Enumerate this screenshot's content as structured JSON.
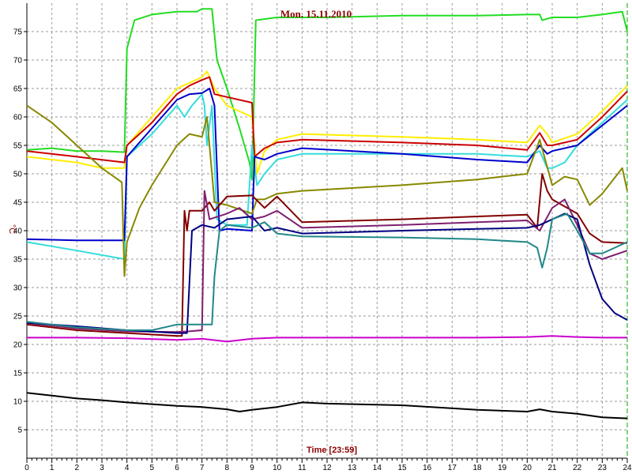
{
  "chart_data": {
    "type": "line",
    "title": "Mon. 15.11.2010",
    "xlabel": "Time [23:59]",
    "ylabel": "°C",
    "xlim": [
      0,
      24
    ],
    "ylim": [
      0,
      80
    ],
    "grid": true,
    "x_ticks": [
      "0",
      "1",
      "2",
      "3",
      "4",
      "5",
      "6",
      "7",
      "8",
      "9",
      "10",
      "11",
      "12",
      "13",
      "14",
      "15",
      "16",
      "17",
      "18",
      "19",
      "20",
      "21",
      "22",
      "23",
      "24"
    ],
    "y_ticks": [
      "5",
      "10",
      "15",
      "20",
      "25",
      "30",
      "35",
      "40",
      "45",
      "50",
      "55",
      "60",
      "65",
      "70",
      "75"
    ],
    "series": [
      {
        "color": "#22dd22",
        "points": [
          [
            0,
            54.2
          ],
          [
            1,
            54.5
          ],
          [
            2,
            54
          ],
          [
            3,
            54
          ],
          [
            3.9,
            53.8
          ],
          [
            4,
            72
          ],
          [
            4.3,
            77
          ],
          [
            5,
            78
          ],
          [
            6,
            78.5
          ],
          [
            6.8,
            78.5
          ],
          [
            7,
            79
          ],
          [
            7.4,
            79
          ],
          [
            7.6,
            70
          ],
          [
            8,
            65
          ],
          [
            8.5,
            58
          ],
          [
            8.9,
            52
          ],
          [
            9,
            49
          ],
          [
            9.15,
            77
          ],
          [
            10,
            77.5
          ],
          [
            12,
            77.5
          ],
          [
            15,
            77.8
          ],
          [
            18,
            77.8
          ],
          [
            20,
            78
          ],
          [
            20.5,
            78
          ],
          [
            20.6,
            77
          ],
          [
            21,
            77.5
          ],
          [
            22,
            77.5
          ],
          [
            23,
            78
          ],
          [
            23.8,
            78.5
          ],
          [
            24,
            75
          ]
        ]
      },
      {
        "color": "#ffee00",
        "points": [
          [
            0,
            53
          ],
          [
            2,
            52
          ],
          [
            3,
            51
          ],
          [
            3.9,
            51
          ],
          [
            4,
            55
          ],
          [
            5,
            60
          ],
          [
            6,
            65
          ],
          [
            6.5,
            66
          ],
          [
            7,
            67
          ],
          [
            7.2,
            68
          ],
          [
            7.5,
            65
          ],
          [
            8,
            62
          ],
          [
            9,
            60
          ],
          [
            9.2,
            50
          ],
          [
            9.5,
            54
          ],
          [
            10,
            56
          ],
          [
            11,
            57
          ],
          [
            15,
            56.5
          ],
          [
            18,
            56
          ],
          [
            20,
            55.5
          ],
          [
            20.5,
            58.5
          ],
          [
            20.8,
            57
          ],
          [
            21,
            55.5
          ],
          [
            22,
            57
          ],
          [
            23,
            61
          ],
          [
            24,
            65.5
          ]
        ]
      },
      {
        "color": "#cc0000",
        "points": [
          [
            0,
            54
          ],
          [
            2,
            53
          ],
          [
            3.9,
            52
          ],
          [
            4,
            55
          ],
          [
            5,
            59
          ],
          [
            6,
            64
          ],
          [
            6.5,
            65.5
          ],
          [
            7,
            66.5
          ],
          [
            7.3,
            67
          ],
          [
            7.5,
            64
          ],
          [
            8,
            63.5
          ],
          [
            9,
            62.5
          ],
          [
            9.1,
            53
          ],
          [
            9.5,
            54.5
          ],
          [
            10,
            55.5
          ],
          [
            11,
            56
          ],
          [
            15,
            55.5
          ],
          [
            18,
            55
          ],
          [
            20,
            54.2
          ],
          [
            20.5,
            57.2
          ],
          [
            20.8,
            55
          ],
          [
            21,
            55
          ],
          [
            22,
            56
          ],
          [
            23,
            60
          ],
          [
            24,
            64.5
          ]
        ]
      },
      {
        "color": "#33dddd",
        "points": [
          [
            0,
            38
          ],
          [
            2,
            36.5
          ],
          [
            3.9,
            35
          ],
          [
            4,
            53
          ],
          [
            5,
            57
          ],
          [
            6,
            62
          ],
          [
            6.3,
            60
          ],
          [
            6.6,
            62
          ],
          [
            7,
            64
          ],
          [
            7.1,
            62
          ],
          [
            7.2,
            55
          ],
          [
            7.4,
            62
          ],
          [
            7.6,
            42
          ],
          [
            8,
            41
          ],
          [
            8.8,
            41
          ],
          [
            9,
            55
          ],
          [
            9.2,
            48
          ],
          [
            9.5,
            50
          ],
          [
            10,
            52.5
          ],
          [
            11,
            53.5
          ],
          [
            15,
            53.5
          ],
          [
            18,
            53.5
          ],
          [
            20,
            53
          ],
          [
            20.5,
            54
          ],
          [
            20.8,
            51
          ],
          [
            21,
            51
          ],
          [
            21.5,
            52
          ],
          [
            22,
            55
          ],
          [
            23,
            59
          ],
          [
            24,
            63
          ]
        ]
      },
      {
        "color": "#0000cc",
        "points": [
          [
            0,
            38.5
          ],
          [
            2,
            38.3
          ],
          [
            3.9,
            38.3
          ],
          [
            4,
            53
          ],
          [
            5,
            58
          ],
          [
            6,
            63
          ],
          [
            6.5,
            64
          ],
          [
            7,
            64.2
          ],
          [
            7.3,
            65
          ],
          [
            7.5,
            62
          ],
          [
            7.7,
            40
          ],
          [
            8,
            40.3
          ],
          [
            9,
            40
          ],
          [
            9.1,
            53
          ],
          [
            9.5,
            52.5
          ],
          [
            10,
            53.5
          ],
          [
            11,
            54.5
          ],
          [
            15,
            53.5
          ],
          [
            18,
            52.5
          ],
          [
            20,
            52
          ],
          [
            20.5,
            55
          ],
          [
            20.8,
            53.5
          ],
          [
            21,
            54
          ],
          [
            22,
            55
          ],
          [
            23,
            58.5
          ],
          [
            24,
            62
          ]
        ]
      },
      {
        "color": "#888800",
        "points": [
          [
            0,
            62
          ],
          [
            1,
            59
          ],
          [
            2,
            55
          ],
          [
            3,
            51
          ],
          [
            3.8,
            48.5
          ],
          [
            3.9,
            32
          ],
          [
            4,
            38
          ],
          [
            4.5,
            44
          ],
          [
            5,
            48
          ],
          [
            6,
            55
          ],
          [
            6.5,
            57
          ],
          [
            7,
            56.5
          ],
          [
            7.2,
            60
          ],
          [
            7.5,
            45
          ],
          [
            8,
            44.5
          ],
          [
            9,
            43
          ],
          [
            9.2,
            45.5
          ],
          [
            9.5,
            45.5
          ],
          [
            10,
            46.5
          ],
          [
            11,
            47
          ],
          [
            15,
            48
          ],
          [
            18,
            49
          ],
          [
            20,
            50
          ],
          [
            20.5,
            56
          ],
          [
            21,
            48
          ],
          [
            21.5,
            49.5
          ],
          [
            22,
            49
          ],
          [
            22.5,
            44.5
          ],
          [
            23,
            46.5
          ],
          [
            23.8,
            51
          ],
          [
            24,
            47
          ]
        ]
      },
      {
        "color": "#800000",
        "points": [
          [
            0,
            23.5
          ],
          [
            2,
            22.5
          ],
          [
            4,
            22
          ],
          [
            6,
            21.5
          ],
          [
            6.2,
            21.5
          ],
          [
            6.3,
            43.5
          ],
          [
            6.4,
            40
          ],
          [
            6.5,
            43.5
          ],
          [
            7,
            43.5
          ],
          [
            7.3,
            45
          ],
          [
            7.5,
            43.5
          ],
          [
            8,
            46
          ],
          [
            9,
            46.2
          ],
          [
            9.5,
            44
          ],
          [
            10,
            46
          ],
          [
            11,
            41.5
          ],
          [
            15,
            42
          ],
          [
            18,
            42.5
          ],
          [
            20,
            42.8
          ],
          [
            20.4,
            40.5
          ],
          [
            20.6,
            50
          ],
          [
            20.8,
            47
          ],
          [
            21,
            45.5
          ],
          [
            22,
            43
          ],
          [
            22.5,
            39.5
          ],
          [
            23,
            38
          ],
          [
            24,
            37.8
          ]
        ]
      },
      {
        "color": "#7f1f6f",
        "points": [
          [
            0,
            23.8
          ],
          [
            2,
            22.8
          ],
          [
            4,
            22.3
          ],
          [
            6,
            22.2
          ],
          [
            6.5,
            22.3
          ],
          [
            7,
            22.5
          ],
          [
            7.1,
            47
          ],
          [
            7.3,
            42
          ],
          [
            8,
            43
          ],
          [
            8.5,
            44
          ],
          [
            9,
            42
          ],
          [
            9.5,
            42.5
          ],
          [
            10,
            43.5
          ],
          [
            11,
            40.5
          ],
          [
            15,
            41
          ],
          [
            18,
            41.5
          ],
          [
            20,
            41.8
          ],
          [
            20.5,
            40
          ],
          [
            21,
            44
          ],
          [
            21.5,
            45.5
          ],
          [
            22,
            41
          ],
          [
            22.5,
            36
          ],
          [
            23,
            35
          ],
          [
            24,
            36.5
          ]
        ]
      },
      {
        "color": "#000080",
        "points": [
          [
            0,
            23.8
          ],
          [
            2,
            23.2
          ],
          [
            4,
            22.5
          ],
          [
            6,
            22
          ],
          [
            6.4,
            22
          ],
          [
            6.6,
            40
          ],
          [
            7,
            41
          ],
          [
            7.5,
            40.5
          ],
          [
            8,
            42
          ],
          [
            9,
            42.5
          ],
          [
            9.5,
            40
          ],
          [
            10,
            40.5
          ],
          [
            11,
            39.5
          ],
          [
            15,
            40
          ],
          [
            18,
            40.3
          ],
          [
            20,
            40.5
          ],
          [
            20.5,
            41
          ],
          [
            21,
            42
          ],
          [
            21.5,
            43
          ],
          [
            22,
            42
          ],
          [
            22.5,
            34
          ],
          [
            23,
            28
          ],
          [
            23.5,
            25.5
          ],
          [
            24,
            24.3
          ]
        ]
      },
      {
        "color": "#228888",
        "points": [
          [
            0,
            24
          ],
          [
            2,
            23
          ],
          [
            4,
            22.5
          ],
          [
            5,
            22.5
          ],
          [
            6,
            23.5
          ],
          [
            7,
            23.5
          ],
          [
            7.4,
            23.5
          ],
          [
            7.5,
            32
          ],
          [
            7.7,
            40
          ],
          [
            8,
            41
          ],
          [
            9,
            40.5
          ],
          [
            9.5,
            41.5
          ],
          [
            10,
            39.5
          ],
          [
            11,
            39
          ],
          [
            15,
            38.8
          ],
          [
            18,
            38.5
          ],
          [
            20,
            38
          ],
          [
            20.4,
            37
          ],
          [
            20.6,
            33.5
          ],
          [
            20.8,
            37
          ],
          [
            21,
            42
          ],
          [
            21.6,
            43
          ],
          [
            22,
            40
          ],
          [
            22.5,
            36
          ],
          [
            23,
            36
          ],
          [
            24,
            38
          ]
        ]
      },
      {
        "color": "#cc00cc",
        "points": [
          [
            0,
            21.2
          ],
          [
            2,
            21.2
          ],
          [
            4,
            21.1
          ],
          [
            6,
            20.8
          ],
          [
            7,
            21
          ],
          [
            8,
            20.5
          ],
          [
            9,
            21
          ],
          [
            10,
            21.2
          ],
          [
            12,
            21.2
          ],
          [
            15,
            21.2
          ],
          [
            18,
            21.2
          ],
          [
            20,
            21.3
          ],
          [
            21,
            21.5
          ],
          [
            22,
            21.3
          ],
          [
            23,
            21.2
          ],
          [
            24,
            21.2
          ]
        ]
      },
      {
        "color": "#000000",
        "points": [
          [
            0,
            11.5
          ],
          [
            1,
            11
          ],
          [
            2,
            10.5
          ],
          [
            3,
            10.2
          ],
          [
            4,
            9.8
          ],
          [
            5,
            9.5
          ],
          [
            6,
            9.2
          ],
          [
            7,
            9
          ],
          [
            8,
            8.6
          ],
          [
            8.5,
            8.2
          ],
          [
            9,
            8.5
          ],
          [
            10,
            9
          ],
          [
            11,
            9.8
          ],
          [
            12,
            9.6
          ],
          [
            15,
            9.3
          ],
          [
            18,
            8.5
          ],
          [
            20,
            8.2
          ],
          [
            20.5,
            8.6
          ],
          [
            21,
            8.2
          ],
          [
            22,
            7.8
          ],
          [
            23,
            7.2
          ],
          [
            24,
            7
          ]
        ]
      }
    ]
  }
}
